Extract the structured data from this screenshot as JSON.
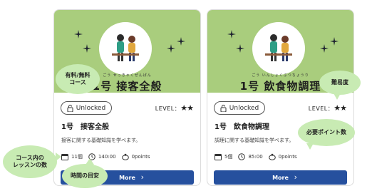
{
  "cards": [
    {
      "furigana": "ごう せっきゃくぜんぱん",
      "title": "1号 接客全般",
      "unlock_label": "Unlocked",
      "level_label": "LEVEL：",
      "level_stars": "★★",
      "name": "1号　接客全般",
      "description": "接客に関する基礎知識を学べます。",
      "lessons": "11個",
      "time": "140:00",
      "points": "0points",
      "more_label": "More"
    },
    {
      "furigana": "ごう いんしょくぶつちょうり",
      "title": "1号 飲食物調理",
      "unlock_label": "Unlocked",
      "level_label": "LEVEL：",
      "level_stars": "★★",
      "name": "1号　飲食物調理",
      "description": "調理に関する基礎知識を学べます。",
      "lessons": "5個",
      "time": "85:00",
      "points": "0points",
      "more_label": "More"
    }
  ],
  "callouts": {
    "paid_free": "有料/無料\nコース",
    "lesson_count": "コース内の\nレッスンの数",
    "time_guide": "時間の目安",
    "difficulty": "難易度",
    "required_points": "必要ポイント数"
  },
  "icons": [
    "lock-icon",
    "calendar-icon",
    "clock-icon",
    "points-icon",
    "chevron-right-icon",
    "sparkle-icon"
  ],
  "colors": {
    "card_header": "#a9cd7d",
    "button": "#26509e",
    "callout": "#c8ebb3"
  }
}
